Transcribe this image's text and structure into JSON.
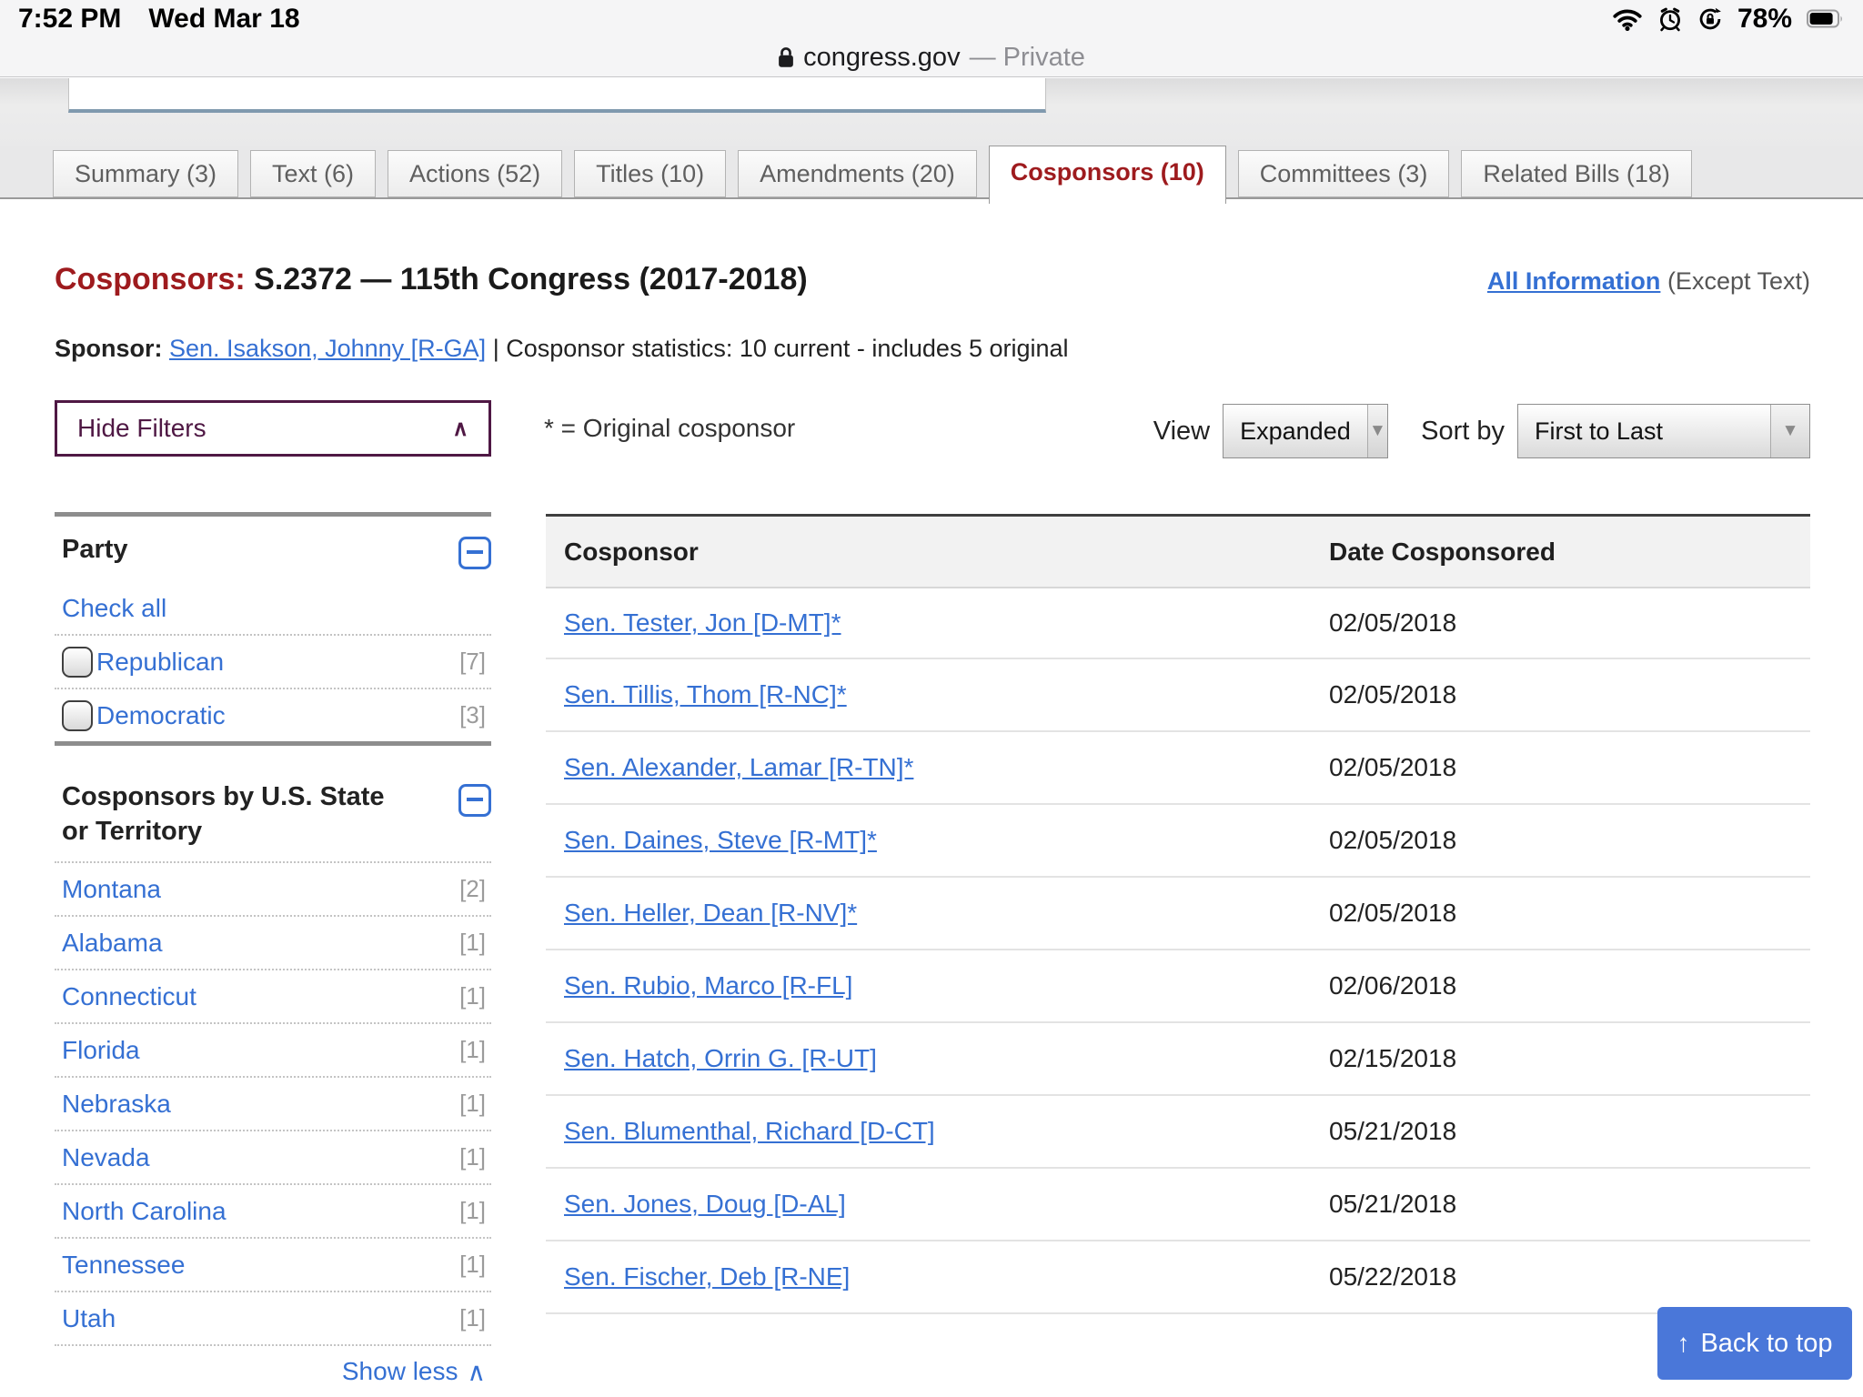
{
  "status_bar": {
    "time": "7:52 PM",
    "date": "Wed Mar 18",
    "battery_percent": "78%"
  },
  "browser": {
    "domain": "congress.gov",
    "privacy": "— Private"
  },
  "tabs": [
    {
      "label": "Summary (3)",
      "active": false
    },
    {
      "label": "Text (6)",
      "active": false
    },
    {
      "label": "Actions (52)",
      "active": false
    },
    {
      "label": "Titles (10)",
      "active": false
    },
    {
      "label": "Amendments (20)",
      "active": false
    },
    {
      "label": "Cosponsors (10)",
      "active": true
    },
    {
      "label": "Committees (3)",
      "active": false
    },
    {
      "label": "Related Bills (18)",
      "active": false
    }
  ],
  "page": {
    "heading_label": "Cosponsors:",
    "heading_title": "S.2372 — 115th Congress (2017-2018)",
    "all_information": "All Information",
    "all_information_suffix": "(Except Text)",
    "sponsor_label": "Sponsor:",
    "sponsor_link": "Sen. Isakson, Johnny [R-GA]",
    "separator": "|",
    "sponsor_stats": "Cosponsor statistics: 10 current - includes 5 original"
  },
  "controls": {
    "hide_filters": "Hide Filters",
    "hide_filters_chevron": "∧",
    "original_note": "* = Original cosponsor",
    "view_label": "View",
    "view_value": "Expanded",
    "sort_label": "Sort by",
    "sort_value": "First to Last",
    "select_arrow": "▼"
  },
  "filters": {
    "party": {
      "title": "Party",
      "check_all": "Check all",
      "options": [
        {
          "label": "Republican",
          "count": "[7]"
        },
        {
          "label": "Democratic",
          "count": "[3]"
        }
      ]
    },
    "states": {
      "title": "Cosponsors by U.S. State or Territory",
      "items": [
        {
          "label": "Montana",
          "count": "[2]"
        },
        {
          "label": "Alabama",
          "count": "[1]"
        },
        {
          "label": "Connecticut",
          "count": "[1]"
        },
        {
          "label": "Florida",
          "count": "[1]"
        },
        {
          "label": "Nebraska",
          "count": "[1]"
        },
        {
          "label": "Nevada",
          "count": "[1]"
        },
        {
          "label": "North Carolina",
          "count": "[1]"
        },
        {
          "label": "Tennessee",
          "count": "[1]"
        },
        {
          "label": "Utah",
          "count": "[1]"
        }
      ],
      "show_less": "Show less",
      "show_less_chevron": "∧"
    }
  },
  "table": {
    "headers": [
      "Cosponsor",
      "Date Cosponsored"
    ],
    "rows": [
      {
        "name": "Sen. Tester, Jon [D-MT]*",
        "date": "02/05/2018"
      },
      {
        "name": "Sen. Tillis, Thom [R-NC]*",
        "date": "02/05/2018"
      },
      {
        "name": "Sen. Alexander, Lamar [R-TN]*",
        "date": "02/05/2018"
      },
      {
        "name": "Sen. Daines, Steve [R-MT]*",
        "date": "02/05/2018"
      },
      {
        "name": "Sen. Heller, Dean [R-NV]*",
        "date": "02/05/2018"
      },
      {
        "name": "Sen. Rubio, Marco [R-FL]",
        "date": "02/06/2018"
      },
      {
        "name": "Sen. Hatch, Orrin G. [R-UT]",
        "date": "02/15/2018"
      },
      {
        "name": "Sen. Blumenthal, Richard [D-CT]",
        "date": "05/21/2018"
      },
      {
        "name": "Sen. Jones, Doug [D-AL]",
        "date": "05/21/2018"
      },
      {
        "name": "Sen. Fischer, Deb [R-NE]",
        "date": "05/22/2018"
      }
    ]
  },
  "back_to_top": {
    "label": "Back to top",
    "icon": "↑"
  },
  "colors": {
    "accent_red": "#9e1b1e",
    "link_blue": "#3570d3",
    "button_blue": "#4a77d9",
    "filter_purple": "#4f1844",
    "steel_border": "#8099ae"
  }
}
